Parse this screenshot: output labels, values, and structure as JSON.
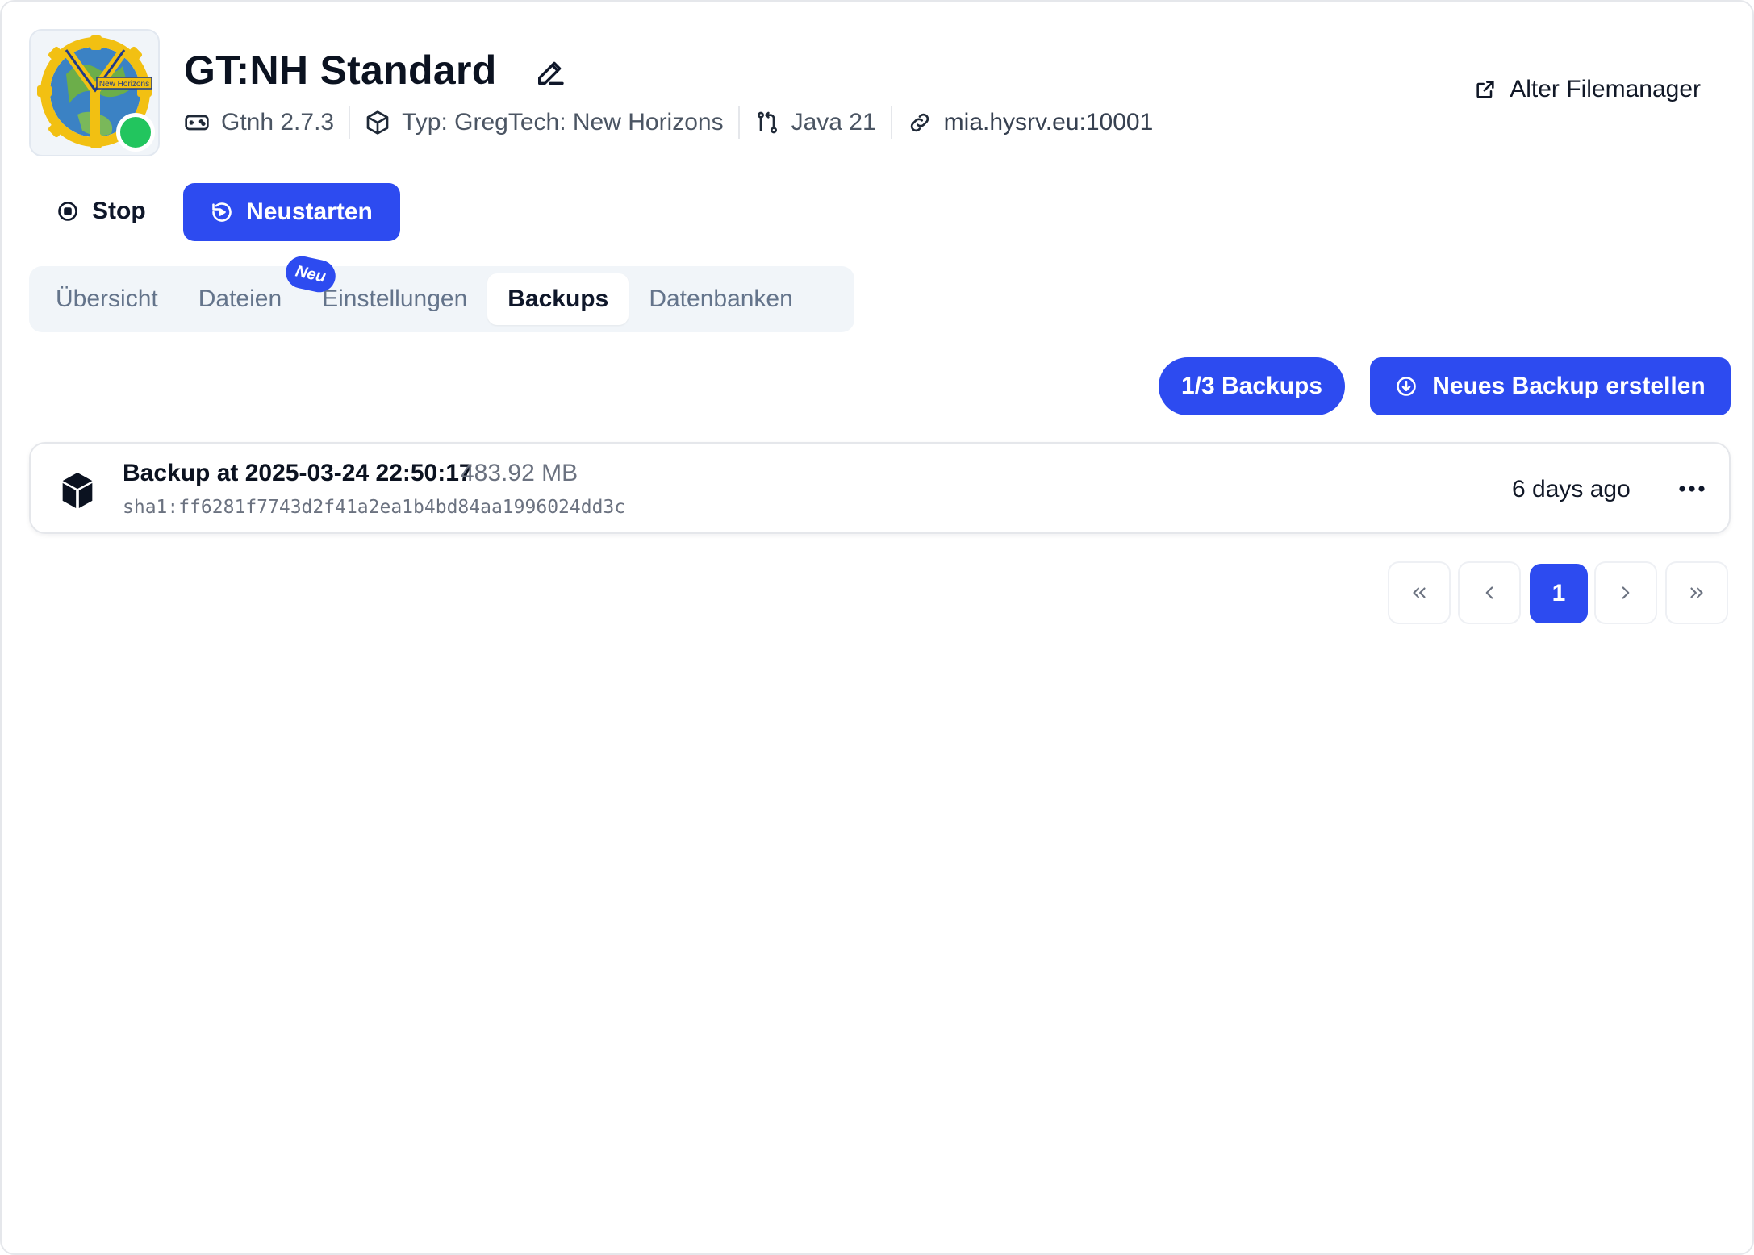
{
  "server": {
    "title": "GT:NH Standard",
    "logo_text": "New Horizons",
    "status": "online",
    "status_color": "#22c55e",
    "meta": {
      "version": "Gtnh 2.7.3",
      "type": "Typ: GregTech: New Horizons",
      "java": "Java 21",
      "address": "mia.hysrv.eu:10001"
    }
  },
  "header_links": {
    "old_filemanager": "Alter Filemanager"
  },
  "actions": {
    "stop": "Stop",
    "restart": "Neustarten"
  },
  "tabs": [
    {
      "label": "Übersicht",
      "active": false
    },
    {
      "label": "Dateien",
      "active": false,
      "badge": "Neu"
    },
    {
      "label": "Einstellungen",
      "active": false
    },
    {
      "label": "Backups",
      "active": true
    },
    {
      "label": "Datenbanken",
      "active": false
    }
  ],
  "backups": {
    "count_label": "1/3 Backups",
    "create_label": "Neues Backup erstellen",
    "items": [
      {
        "name": "Backup at 2025-03-24 22:50:17",
        "size": "483.92 MB",
        "hash": "sha1:ff6281f7743d2f41a2ea1b4bd84aa1996024dd3c",
        "age": "6 days ago"
      }
    ]
  },
  "pagination": {
    "current": "1"
  },
  "colors": {
    "accent": "#2d4bf0",
    "muted": "#64748b",
    "tabs_bg": "#f1f5f9"
  }
}
